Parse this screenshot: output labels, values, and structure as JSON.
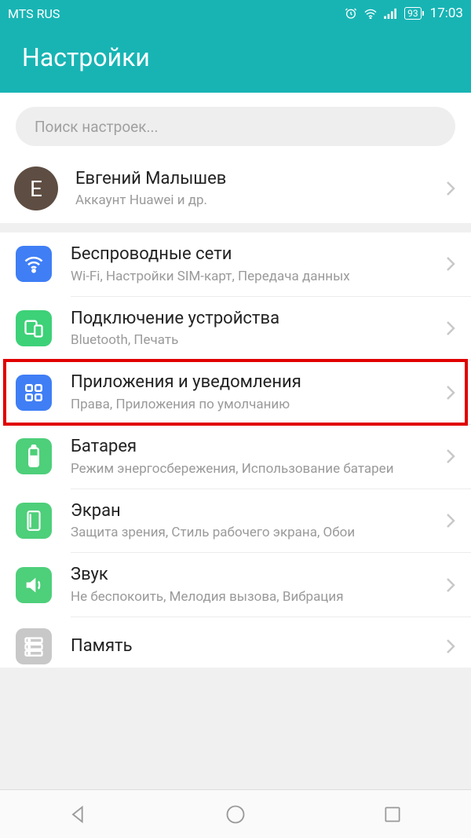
{
  "status": {
    "carrier": "MTS RUS",
    "battery": "93",
    "time": "17:03"
  },
  "header": {
    "title": "Настройки"
  },
  "search": {
    "placeholder": "Поиск настроек..."
  },
  "account": {
    "initial": "Е",
    "name": "Евгений Малышев",
    "sub": "Аккаунт Huawei и др."
  },
  "items": [
    {
      "title": "Беспроводные сети",
      "sub": "Wi-Fi, Настройки SIM-карт, Передача данных"
    },
    {
      "title": "Подключение устройства",
      "sub": "Bluetooth, Печать"
    },
    {
      "title": "Приложения и уведомления",
      "sub": "Права, Приложения по умолчанию"
    },
    {
      "title": "Батарея",
      "sub": "Режим энергосбережения, Использование батареи"
    },
    {
      "title": "Экран",
      "sub": "Защита зрения, Стиль рабочего экрана, Обои"
    },
    {
      "title": "Звук",
      "sub": "Не беспокоить, Мелодия вызова, Вибрация"
    },
    {
      "title": "Память",
      "sub": ""
    }
  ]
}
